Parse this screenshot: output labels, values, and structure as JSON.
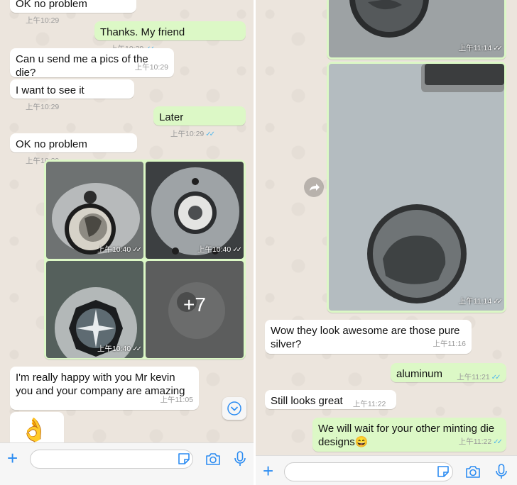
{
  "left": {
    "messages": {
      "m0": {
        "text": "OK no problem",
        "time": "上午10:29"
      },
      "m1": {
        "text": "Thanks. My friend",
        "time": "上午10:29",
        "ticks": "✓✓"
      },
      "m2": {
        "text": "Can u send me a pics of the die?",
        "time": "上午10:29"
      },
      "m3": {
        "text": "I want to see it",
        "time": "上午10:29"
      },
      "m4": {
        "text": "Later",
        "time": "上午10:29",
        "ticks": "✓✓"
      },
      "m5": {
        "text": "OK no problem",
        "time": "上午10:29"
      },
      "album": {
        "t1": "上午10:40",
        "t2": "上午10:40",
        "t3": "上午10:40",
        "more": "+7",
        "ticks": "✓✓"
      },
      "m6": {
        "text": "I'm really happy with you Mr kevin you and your company are amazing",
        "time": "上午11:05"
      },
      "m7": {
        "emoji": "👌"
      }
    }
  },
  "right": {
    "photos": {
      "p1_time": "上午11:14",
      "p2_time": "上午11:14",
      "ticks": "✓✓"
    },
    "messages": {
      "m1": {
        "text": "Wow they look awesome are those pure silver?",
        "time": "上午11:16"
      },
      "m2": {
        "text": "aluminum",
        "time": "上午11:21",
        "ticks": "✓✓"
      },
      "m3": {
        "text": "Still looks great",
        "time": "上午11:22"
      },
      "m4": {
        "text": "We will wait for your other minting die designs😄",
        "time": "上午11:22",
        "ticks": "✓✓"
      }
    }
  },
  "icons": {
    "add": "plus-icon",
    "sticker": "sticker-icon",
    "camera": "camera-icon",
    "mic": "microphone-icon",
    "scroll": "chevron-down-icon",
    "forward": "forward-icon"
  },
  "colors": {
    "outgoing": "#dcf8c6",
    "incoming": "#ffffff",
    "accent": "#2b8cf2",
    "read_tick": "#4fb6ec",
    "chat_bg": "#ece5dd"
  }
}
